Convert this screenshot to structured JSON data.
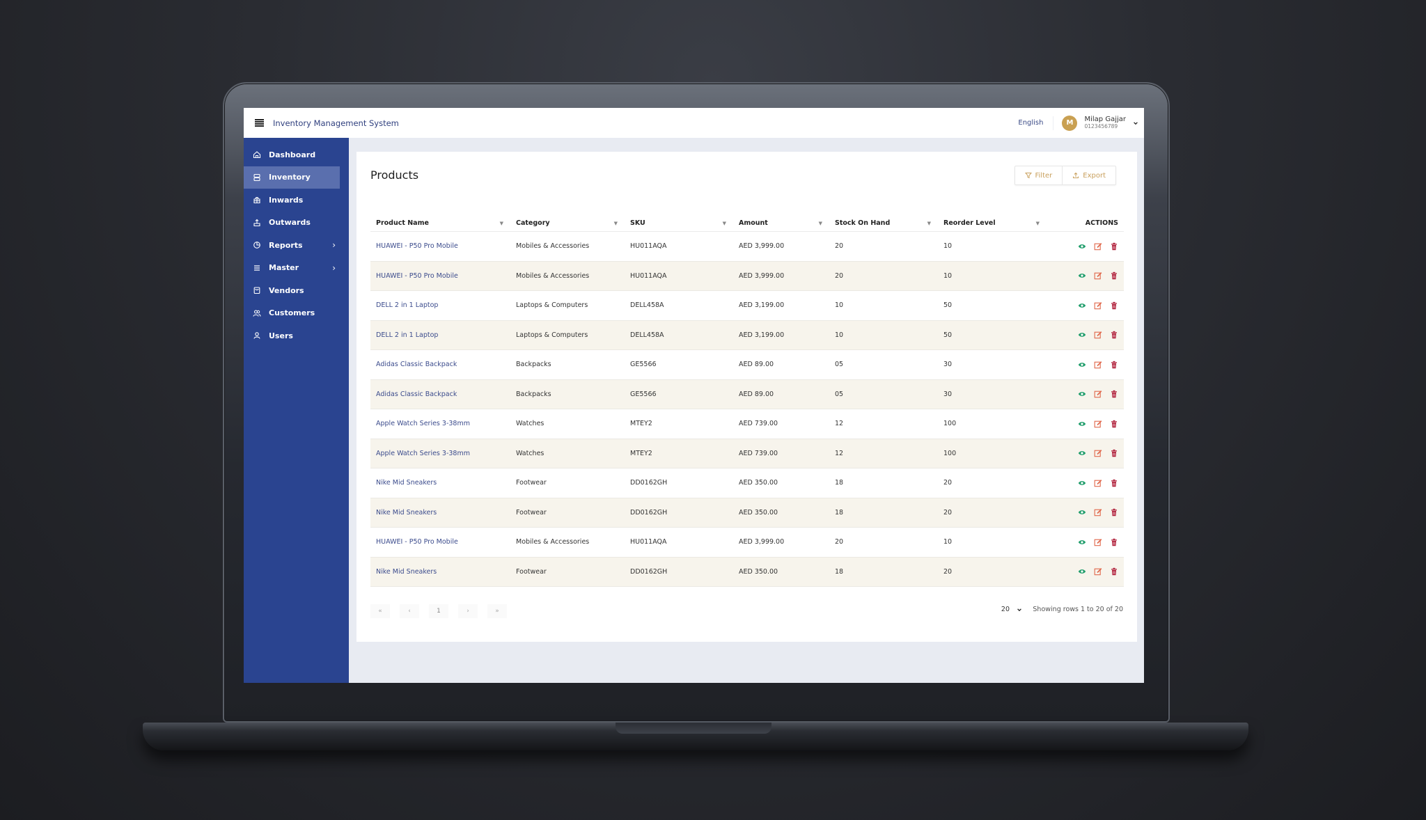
{
  "app": {
    "title": "Inventory Management System",
    "language": "English",
    "user": {
      "initial": "M",
      "name": "Milap Gajjar",
      "phone": "0123456789"
    }
  },
  "colors": {
    "sidebar": "#2a4490",
    "sidebar_active": "#5a6fae",
    "accent_gold": "#c9a05d",
    "link": "#3b4b8c",
    "view_icon": "#1f9d6b",
    "edit_icon": "#e0674a",
    "delete_icon": "#b01f3a",
    "row_alt": "#f7f4ec"
  },
  "sidebar": {
    "items": [
      {
        "label": "Dashboard",
        "icon": "home-icon"
      },
      {
        "label": "Inventory",
        "icon": "database-icon",
        "active": true
      },
      {
        "label": "Inwards",
        "icon": "box-in-icon"
      },
      {
        "label": "Outwards",
        "icon": "box-out-icon"
      },
      {
        "label": "Reports",
        "icon": "pie-chart-icon",
        "submenu": "›"
      },
      {
        "label": "Master",
        "icon": "list-icon",
        "submenu": "›"
      },
      {
        "label": "Vendors",
        "icon": "vendor-icon"
      },
      {
        "label": "Customers",
        "icon": "customers-icon"
      },
      {
        "label": "Users",
        "icon": "user-icon"
      }
    ]
  },
  "page": {
    "title": "Products",
    "filter_label": "Filter",
    "export_label": "Export"
  },
  "table": {
    "columns": [
      "Product Name",
      "Category",
      "SKU",
      "Amount",
      "Stock On Hand",
      "Reorder Level",
      "ACTIONS"
    ],
    "rows": [
      {
        "name": "HUAWEI - P50 Pro Mobile",
        "category": "Mobiles & Accessories",
        "sku": "HU011AQA",
        "amount": "AED 3,999.00",
        "stock": "20",
        "reorder": "10"
      },
      {
        "name": "HUAWEI - P50 Pro Mobile",
        "category": "Mobiles & Accessories",
        "sku": "HU011AQA",
        "amount": "AED 3,999.00",
        "stock": "20",
        "reorder": "10"
      },
      {
        "name": "DELL 2 in 1 Laptop",
        "category": "Laptops & Computers",
        "sku": "DELL458A",
        "amount": "AED 3,199.00",
        "stock": "10",
        "reorder": "50"
      },
      {
        "name": "DELL 2 in 1 Laptop",
        "category": "Laptops & Computers",
        "sku": "DELL458A",
        "amount": "AED 3,199.00",
        "stock": "10",
        "reorder": "50"
      },
      {
        "name": "Adidas Classic Backpack",
        "category": "Backpacks",
        "sku": "GE5566",
        "amount": "AED 89.00",
        "stock": "05",
        "reorder": "30"
      },
      {
        "name": "Adidas Classic Backpack",
        "category": "Backpacks",
        "sku": "GE5566",
        "amount": "AED 89.00",
        "stock": "05",
        "reorder": "30"
      },
      {
        "name": "Apple Watch Series 3-38mm",
        "category": "Watches",
        "sku": "MTEY2",
        "amount": "AED 739.00",
        "stock": "12",
        "reorder": "100"
      },
      {
        "name": "Apple Watch Series 3-38mm",
        "category": "Watches",
        "sku": "MTEY2",
        "amount": "AED 739.00",
        "stock": "12",
        "reorder": "100"
      },
      {
        "name": "Nike Mid Sneakers",
        "category": "Footwear",
        "sku": "DD0162GH",
        "amount": "AED 350.00",
        "stock": "18",
        "reorder": "20"
      },
      {
        "name": "Nike Mid Sneakers",
        "category": "Footwear",
        "sku": "DD0162GH",
        "amount": "AED 350.00",
        "stock": "18",
        "reorder": "20"
      },
      {
        "name": "HUAWEI - P50 Pro Mobile",
        "category": "Mobiles & Accessories",
        "sku": "HU011AQA",
        "amount": "AED 3,999.00",
        "stock": "20",
        "reorder": "10"
      },
      {
        "name": "Nike Mid Sneakers",
        "category": "Footwear",
        "sku": "DD0162GH",
        "amount": "AED 350.00",
        "stock": "18",
        "reorder": "20"
      }
    ]
  },
  "pagination": {
    "first": "«",
    "prev": "‹",
    "current": "1",
    "next": "›",
    "last": "»",
    "page_size": "20",
    "info": "Showing rows 1 to 20 of 20"
  }
}
